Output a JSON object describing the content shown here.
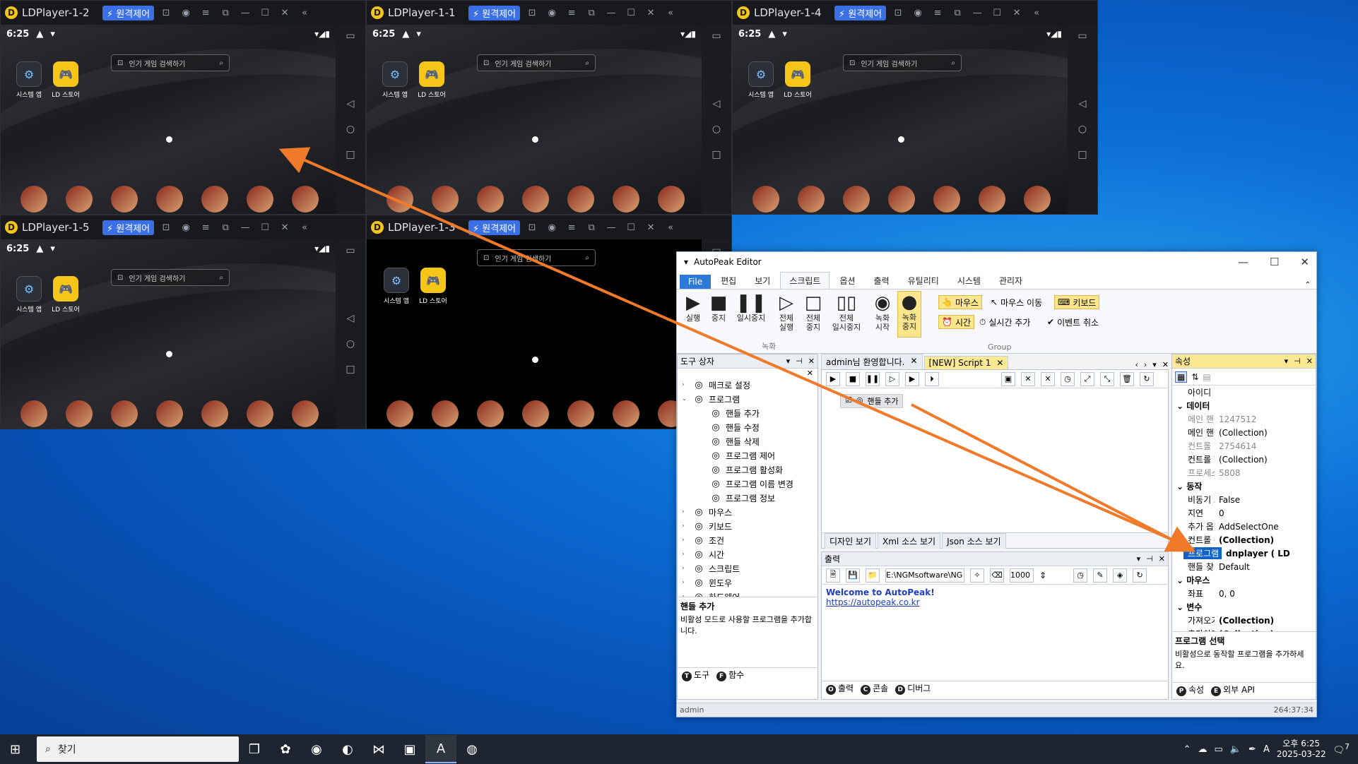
{
  "emulators": [
    {
      "title": "LDPlayer-1-2",
      "remote": "원격제어",
      "time": "6:25",
      "search": "인기 게임 검색하기",
      "apps": [
        "시스템 앱",
        "LD 스토어"
      ],
      "black": false
    },
    {
      "title": "LDPlayer-1-1",
      "remote": "원격제어",
      "time": "6:25",
      "search": "인기 게임 검색하기",
      "apps": [
        "시스템 앱",
        "LD 스토어"
      ],
      "black": false
    },
    {
      "title": "LDPlayer-1-4",
      "remote": "원격제어",
      "time": "6:25",
      "search": "인기 게임 검색하기",
      "apps": [
        "시스템 앱",
        "LD 스토어"
      ],
      "black": false
    },
    {
      "title": "LDPlayer-1-5",
      "remote": "원격제어",
      "time": "6:25",
      "search": "인기 게임 검색하기",
      "apps": [
        "시스템 앱",
        "LD 스토어"
      ],
      "black": false
    },
    {
      "title": "LDPlayer-1-3",
      "remote": "원격제어",
      "time": "",
      "search": "인기 게임 검색하기",
      "apps": [
        "시스템 앱",
        "LD 스토어"
      ],
      "black": true
    }
  ],
  "editor": {
    "title": "AutoPeak Editor",
    "menu": [
      "File",
      "편집",
      "보기",
      "스크립트",
      "옵션",
      "출력",
      "유틸리티",
      "시스템",
      "관리자"
    ],
    "ribbon": {
      "run": "실행",
      "stop": "중지",
      "pause": "일시중지",
      "all_run": [
        "전체",
        "실행"
      ],
      "all_stop": [
        "전체",
        "중지"
      ],
      "all_pause": [
        "전체",
        "일시중지"
      ],
      "rec_start": [
        "녹화",
        "시작"
      ],
      "rec_stop": [
        "녹화",
        "중지"
      ],
      "group_rec": "녹화",
      "group": "Group",
      "mouse": "마우스",
      "mouse_move": "마우스 이동",
      "keyboard": "키보드",
      "time": "시간",
      "realtime_add": "실시간 추가",
      "event_cancel": "이벤트 취소"
    },
    "toolbox": {
      "title": "도구 상자",
      "items": [
        {
          "label": "매크로 설정",
          "level": 0,
          "arrow": "›"
        },
        {
          "label": "프로그램",
          "level": 0,
          "arrow": "⌄"
        },
        {
          "label": "핸들 추가",
          "level": 1,
          "arrow": ""
        },
        {
          "label": "핸들 수정",
          "level": 1,
          "arrow": ""
        },
        {
          "label": "핸들 삭제",
          "level": 1,
          "arrow": ""
        },
        {
          "label": "프로그램 제어",
          "level": 1,
          "arrow": ""
        },
        {
          "label": "프로그램 활성화",
          "level": 1,
          "arrow": ""
        },
        {
          "label": "프로그램 이름 변경",
          "level": 1,
          "arrow": ""
        },
        {
          "label": "프로그램 정보",
          "level": 1,
          "arrow": ""
        },
        {
          "label": "마우스",
          "level": 0,
          "arrow": "›"
        },
        {
          "label": "키보드",
          "level": 0,
          "arrow": "›"
        },
        {
          "label": "조건",
          "level": 0,
          "arrow": "›"
        },
        {
          "label": "시간",
          "level": 0,
          "arrow": "›"
        },
        {
          "label": "스크립트",
          "level": 0,
          "arrow": "›"
        },
        {
          "label": "윈도우",
          "level": 0,
          "arrow": "›"
        },
        {
          "label": "하드웨어",
          "level": 0,
          "arrow": "›"
        }
      ],
      "desc_title": "핸들 추가",
      "desc_body": "비활성 모드로 사용할 프로그램을 추가합니다.",
      "bottom_tabs": [
        "도구",
        "함수"
      ]
    },
    "doc_tabs": [
      {
        "label": "admin님 환영합니다.",
        "active": false
      },
      {
        "label": "[NEW] Script 1",
        "active": true
      }
    ],
    "script_node": "핸들 추가",
    "view_tabs": [
      "디자인 보기",
      "Xml 소스 보기",
      "Json 소스 보기"
    ],
    "output": {
      "title": "출력",
      "path": "E:\\NGMsoftware\\NG",
      "delay": "1000",
      "line1": "Welcome to AutoPeak!",
      "line2": "https://autopeak.co.kr",
      "bottom_tabs": [
        "출력",
        "콘솔",
        "디버그"
      ]
    },
    "props": {
      "title": "속성",
      "rows": [
        {
          "k": "아이디",
          "v": "",
          "t": "plain"
        },
        {
          "k": "데이터",
          "v": "",
          "t": "cat"
        },
        {
          "k": "메인 핸들",
          "v": "1247512",
          "t": "gray"
        },
        {
          "k": "메인 핸들",
          "v": "(Collection)",
          "t": "plain"
        },
        {
          "k": "컨트롤 핸",
          "v": "2754614",
          "t": "gray"
        },
        {
          "k": "컨트롤 핸",
          "v": "(Collection)",
          "t": "plain"
        },
        {
          "k": "프로세스 I",
          "v": "5808",
          "t": "gray"
        },
        {
          "k": "동작",
          "v": "",
          "t": "cat"
        },
        {
          "k": "비동기 모",
          "v": "False",
          "t": "plain"
        },
        {
          "k": "지연",
          "v": "0",
          "t": "plain"
        },
        {
          "k": "추가 옵션",
          "v": "AddSelectOne",
          "t": "plain"
        },
        {
          "k": "컨트롤 위",
          "v": "(Collection)",
          "t": "bold"
        },
        {
          "k": "프로그램",
          "v": "dnplayer ( LD",
          "t": "sel"
        },
        {
          "k": "핸들 찾기",
          "v": "Default",
          "t": "plain"
        },
        {
          "k": "마우스",
          "v": "",
          "t": "cat"
        },
        {
          "k": "좌표",
          "v": "0, 0",
          "t": "plain"
        },
        {
          "k": "변수",
          "v": "",
          "t": "cat"
        },
        {
          "k": "가져오기",
          "v": "(Collection)",
          "t": "bold"
        },
        {
          "k": "추가하기",
          "v": "(Collection)",
          "t": "bold"
        }
      ],
      "desc_title": "프로그램 선택",
      "desc_body": "비활성으로 동작할 프로그램을 추가하세요.",
      "bottom_tabs": [
        "속성",
        "외부 API"
      ]
    },
    "status_left": "admin",
    "status_right": "264:37:34"
  },
  "taskbar": {
    "search": "찾기",
    "time": "오후 6:25",
    "date": "2025-03-22",
    "notif": "7"
  },
  "colors": {
    "arrow": "#f07a2a",
    "accent": "#1062c9"
  }
}
